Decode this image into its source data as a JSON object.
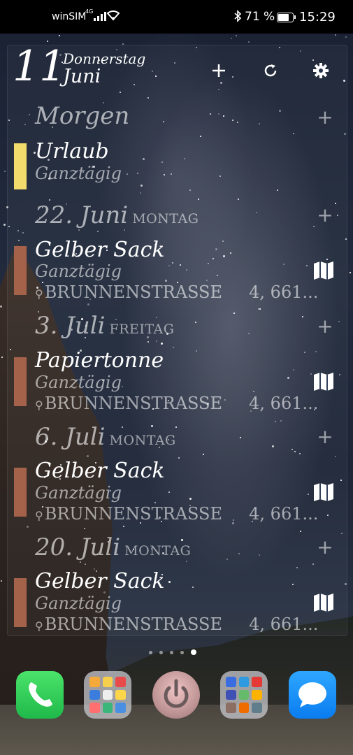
{
  "status_bar": {
    "carrier": "winSIM",
    "network": "4G",
    "battery_percent": "71 %",
    "time": "15:29"
  },
  "header": {
    "day": "11",
    "weekday": "Donnerstag",
    "month": "Juni",
    "icons": [
      "plus-icon",
      "refresh-icon",
      "settings-gear-icon"
    ]
  },
  "agenda": [
    {
      "date": "Morgen",
      "weekday": "",
      "events": [
        {
          "title": "Urlaub",
          "time": "Ganztägig",
          "location": "",
          "color": "#f2dc6b"
        }
      ]
    },
    {
      "date": "22. Juni",
      "weekday": "MONTAG",
      "events": [
        {
          "title": "Gelber Sack",
          "time": "Ganztägig",
          "location": "BRUNNENSTRASSE     4, 661...",
          "color": "#a5624a"
        }
      ]
    },
    {
      "date": "3. Juli",
      "weekday": "FREITAG",
      "events": [
        {
          "title": "Papiertonne",
          "time": "Ganztägig",
          "location": "BRUNNENSTRASSE     4, 661...",
          "color": "#a5624a"
        }
      ]
    },
    {
      "date": "6. Juli",
      "weekday": "MONTAG",
      "events": [
        {
          "title": "Gelber Sack",
          "time": "Ganztägig",
          "location": "BRUNNENSTRASSE     4, 661...",
          "color": "#a5624a"
        }
      ]
    },
    {
      "date": "20. Juli",
      "weekday": "MONTAG",
      "events": [
        {
          "title": "Gelber Sack",
          "time": "Ganztägig",
          "location": "BRUNNENSTRASSE     4, 661...",
          "color": "#a5624a"
        }
      ]
    }
  ],
  "home": {
    "page_count": 5,
    "active_page": 5,
    "dock": [
      "phone-icon",
      "app-folder-1-icon",
      "power-app-icon",
      "app-folder-2-icon",
      "messages-icon"
    ]
  }
}
